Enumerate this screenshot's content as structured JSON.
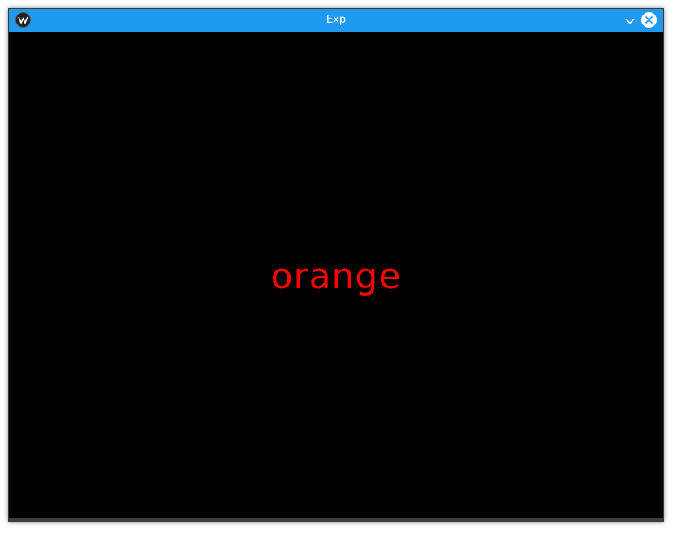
{
  "window": {
    "title": "Exp",
    "titlebar_color": "#1e9bf0",
    "background_color": "#000000"
  },
  "controls": {
    "app_icon": "app-logo-icon",
    "minimize_icon": "chevron-down-icon",
    "close_icon": "close-icon"
  },
  "content": {
    "word": "orange",
    "word_color": "#ff0000"
  }
}
